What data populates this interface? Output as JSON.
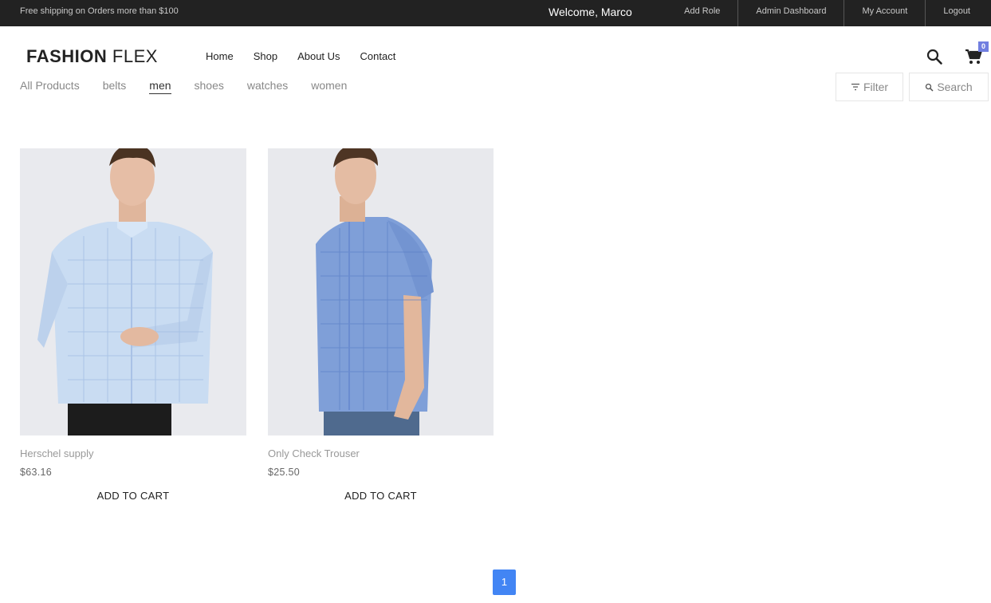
{
  "topbar": {
    "shipping_text": "Free shipping on Orders more than $100",
    "welcome": "Welcome, Marco",
    "links": [
      "Add Role",
      "Admin Dashboard",
      "My Account",
      "Logout"
    ]
  },
  "header": {
    "logo_bold": "FASHION",
    "logo_light": "FLEX",
    "nav": [
      "Home",
      "Shop",
      "About Us",
      "Contact"
    ],
    "cart_count": "0",
    "icons": [
      "search-icon",
      "cart-icon"
    ]
  },
  "categories": {
    "items": [
      "All Products",
      "belts",
      "men",
      "shoes",
      "watches",
      "women"
    ],
    "active": "men"
  },
  "toolbar": {
    "filter_label": "Filter",
    "search_label": "Search"
  },
  "products": [
    {
      "name": "Herschel supply",
      "price": "$63.16",
      "add_label": "ADD TO CART",
      "shirt_color": "#c9dcf2"
    },
    {
      "name": "Only Check Trouser",
      "price": "$25.50",
      "add_label": "ADD TO CART",
      "shirt_color": "#7f9fd8"
    }
  ],
  "pagination": {
    "current": "1"
  },
  "colors": {
    "topbar": "#222222",
    "accent": "#717fe0",
    "page_active": "#4285f4"
  }
}
